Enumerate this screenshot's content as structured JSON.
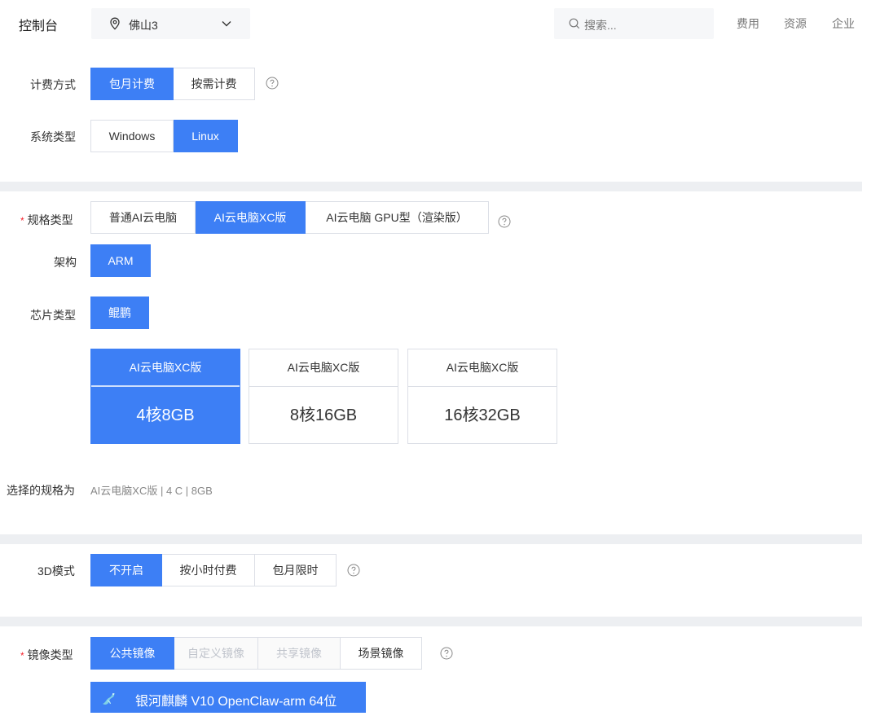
{
  "header": {
    "console_label": "控制台",
    "region": "佛山3",
    "search_placeholder": "搜索...",
    "nav": [
      "费用",
      "资源",
      "企业"
    ]
  },
  "billing": {
    "label": "计费方式",
    "options": [
      "包月计费",
      "按需计费"
    ],
    "selected": "包月计费"
  },
  "os": {
    "label": "系统类型",
    "options": [
      "Windows",
      "Linux"
    ],
    "selected": "Linux"
  },
  "spec_type": {
    "required_mark": "*",
    "label": "规格类型",
    "options": [
      "普通AI云电脑",
      "AI云电脑XC版",
      "AI云电脑 GPU型（渲染版）"
    ],
    "selected": "AI云电脑XC版"
  },
  "arch": {
    "label": "架构",
    "options": [
      "ARM"
    ],
    "selected": "ARM"
  },
  "chip": {
    "label": "芯片类型",
    "options": [
      "鲲鹏"
    ],
    "selected": "鲲鹏"
  },
  "spec_cards": [
    {
      "title": "AI云电脑XC版",
      "spec": "4核8GB",
      "selected": true
    },
    {
      "title": "AI云电脑XC版",
      "spec": "8核16GB",
      "selected": false
    },
    {
      "title": "AI云电脑XC版",
      "spec": "16核32GB",
      "selected": false
    }
  ],
  "selection": {
    "label": "选择的规格为",
    "value": "AI云电脑XC版 | 4 C | 8GB"
  },
  "mode3d": {
    "label": "3D模式",
    "options": [
      "不开启",
      "按小时付费",
      "包月限时"
    ],
    "selected": "不开启"
  },
  "image_type": {
    "required_mark": "*",
    "label": "镜像类型",
    "options": [
      "公共镜像",
      "自定义镜像",
      "共享镜像",
      "场景镜像"
    ],
    "selected": "公共镜像",
    "disabled": [
      "自定义镜像",
      "共享镜像"
    ]
  },
  "image": {
    "name": "银河麒麟 V10  OpenClaw-arm 64位"
  },
  "colors": {
    "accent": "#3d7ff5",
    "divider": "#edeff2",
    "required": "#f5222d"
  }
}
